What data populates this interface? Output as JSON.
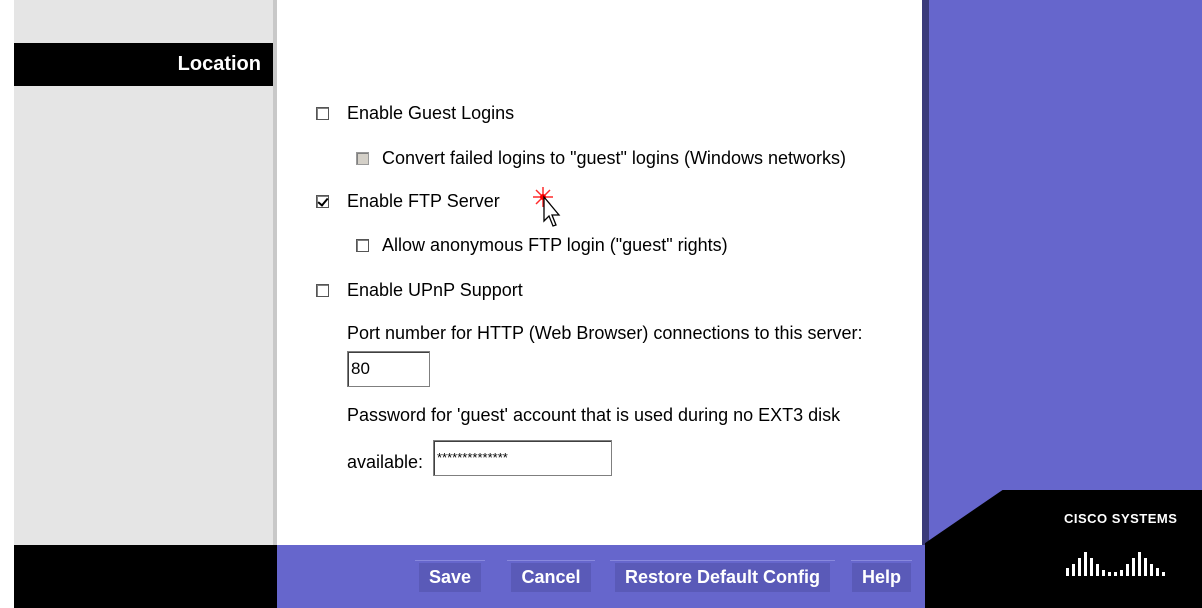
{
  "sidebar": {
    "location_label": "Location"
  },
  "options": {
    "guest_logins": {
      "label": "Enable Guest Logins",
      "checked": false
    },
    "convert_failed": {
      "label": "Convert failed logins to \"guest\" logins (Windows networks)",
      "checked": false,
      "disabled": true
    },
    "ftp_server": {
      "label": "Enable FTP Server",
      "checked": true
    },
    "anonymous_ftp": {
      "label": "Allow anonymous FTP login (\"guest\" rights)",
      "checked": false
    },
    "upnp": {
      "label": "Enable UPnP Support",
      "checked": false
    }
  },
  "http_port": {
    "label": "Port number for HTTP (Web Browser) connections to this server:",
    "value": "80"
  },
  "guest_password": {
    "label_line1": "Password for 'guest' account that is used during no EXT3 disk",
    "label_line2": "available:",
    "value": "**************"
  },
  "buttons": {
    "save": "Save",
    "cancel": "Cancel",
    "restore": "Restore Default Config",
    "help": "Help"
  },
  "brand": {
    "name": "CISCO SYSTEMS"
  },
  "colors": {
    "accent_purple": "#6666cc",
    "sidebar_gray": "#e5e5e5",
    "black": "#000000"
  }
}
